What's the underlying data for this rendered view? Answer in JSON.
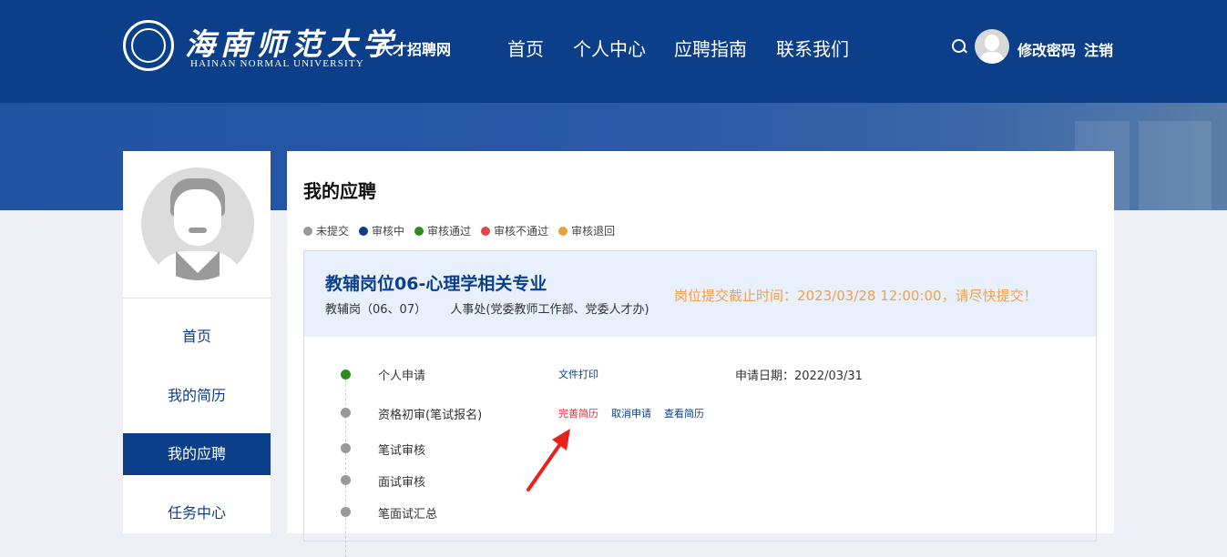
{
  "header": {
    "logo_cn": "海南师范大学",
    "logo_en": "HAINAN NORMAL UNIVERSITY",
    "site_name": "人才招聘网",
    "nav": [
      "首页",
      "个人中心",
      "应聘指南",
      "联系我们"
    ],
    "change_password": "修改密码",
    "logout": "注销",
    "icons": [
      "search-icon",
      "avatar"
    ]
  },
  "sidebar": {
    "items": [
      "首页",
      "我的简历",
      "我的应聘",
      "任务中心"
    ],
    "active": "我的应聘"
  },
  "main": {
    "title": "我的应聘",
    "legend": [
      {
        "label": "未提交",
        "color": "#999999"
      },
      {
        "label": "审核中",
        "color": "#0c3f89"
      },
      {
        "label": "审核通过",
        "color": "#2e8b1e"
      },
      {
        "label": "审核不通过",
        "color": "#e04848"
      },
      {
        "label": "审核退回",
        "color": "#e8a23a"
      }
    ],
    "application": {
      "job_title": "教辅岗位06-心理学相关专业",
      "job_category": "教辅岗（06、07）",
      "department": "人事处(党委教师工作部、党委人才办)",
      "deadline_text": "岗位提交截止时间：2023/03/28 12:00:00，请尽快提交！",
      "apply_date_label": "申请日期：",
      "apply_date": "2022/03/31",
      "steps": [
        {
          "label": "个人申请",
          "status_color": "#2e8b1e"
        },
        {
          "label": "资格初审(笔试报名)",
          "status_color": "#999999"
        },
        {
          "label": "笔试审核",
          "status_color": "#999999"
        },
        {
          "label": "面试审核",
          "status_color": "#999999"
        },
        {
          "label": "笔面试汇总",
          "status_color": "#999999"
        }
      ],
      "step1_action": "文件打印",
      "step2_actions": [
        "完善简历",
        "取消申请",
        "查看简历"
      ]
    }
  },
  "colors": {
    "primary": "#0c3f89",
    "accent_red": "#d9333f",
    "deadline": "#f0a050"
  }
}
